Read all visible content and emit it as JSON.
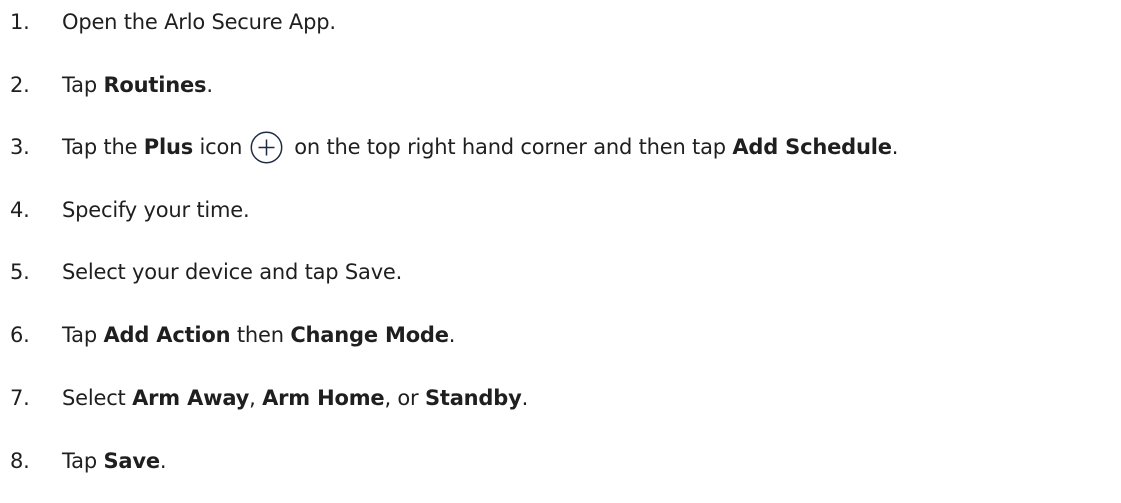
{
  "steps": [
    {
      "num": "1.",
      "parts": [
        "Open the Arlo Secure App."
      ]
    },
    {
      "num": "2.",
      "parts": [
        "Tap ",
        "Routines",
        "."
      ]
    },
    {
      "num": "3.",
      "parts": [
        "Tap the ",
        "Plus",
        " icon",
        "on the top right hand corner and then tap ",
        "Add Schedule",
        "."
      ],
      "icon": "plus-circle-icon"
    },
    {
      "num": "4.",
      "parts": [
        "Specify your time."
      ]
    },
    {
      "num": "5.",
      "parts": [
        "Select your device and tap Save."
      ]
    },
    {
      "num": "6.",
      "parts": [
        "Tap ",
        "Add Action",
        " then ",
        "Change Mode",
        "."
      ]
    },
    {
      "num": "7.",
      "parts": [
        "Select ",
        "Arm Away",
        ", ",
        "Arm Home",
        ", or ",
        "Standby",
        "."
      ]
    },
    {
      "num": "8.",
      "parts": [
        "Tap ",
        "Save",
        "."
      ]
    }
  ],
  "colors": {
    "text": "#1f1f1f",
    "icon_stroke": "#1f2a44"
  }
}
